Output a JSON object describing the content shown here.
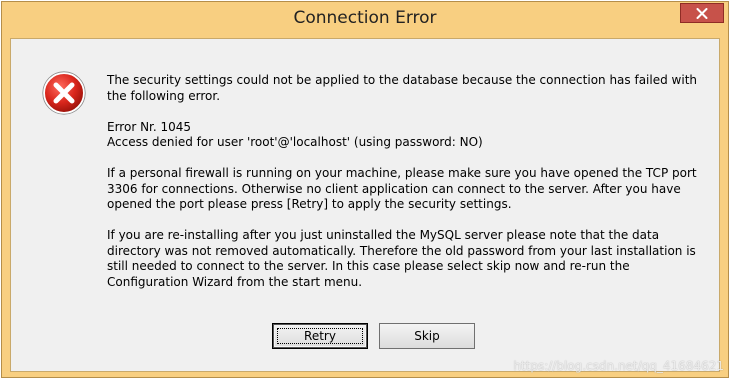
{
  "window": {
    "title": "Connection Error"
  },
  "message": {
    "paragraphs": [
      "The security settings could not be applied to the database because the connection has failed with the following error.",
      "Error Nr. 1045\nAccess denied for user 'root'@'localhost' (using password: NO)",
      "If a personal firewall is running on your machine, please make sure you have opened the TCP port 3306 for connections. Otherwise no client application can connect to the server. After you have opened the port please press [Retry] to apply the security settings.",
      "If you are re-installing after you just uninstalled the MySQL server please note that the data directory was not removed automatically. Therefore the old password from your last installation is still needed to connect to the server. In this case please select skip now and re-run the Configuration Wizard from the start menu."
    ]
  },
  "buttons": {
    "retry": "Retry",
    "skip": "Skip"
  },
  "watermark": "https://blog.csdn.net/qq_41684621",
  "icons": {
    "error": "error-icon",
    "close": "close-icon"
  },
  "colors": {
    "titlebar": "#f8cf81",
    "close_button": "#c7524a",
    "error_red": "#d9261c",
    "client_bg": "#f0f0f0"
  }
}
